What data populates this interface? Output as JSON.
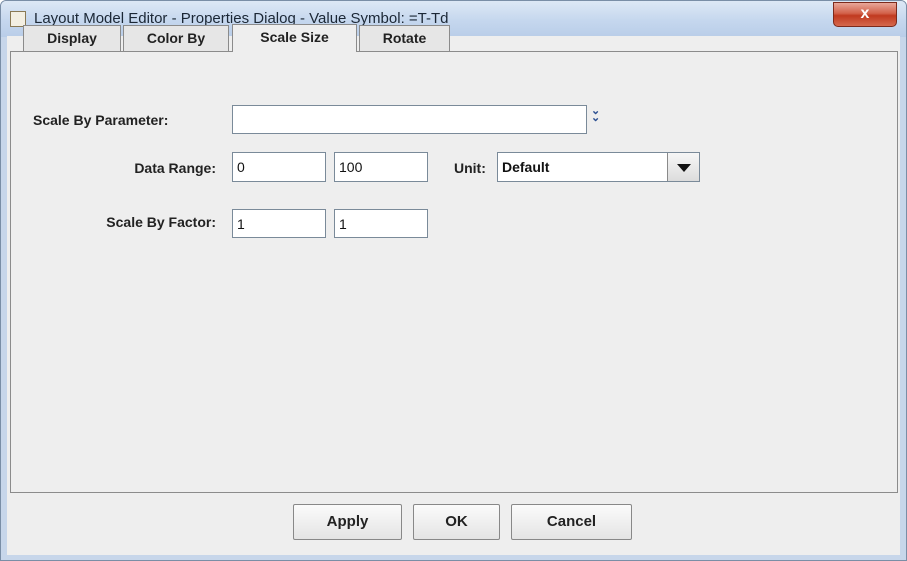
{
  "window": {
    "title": "Layout Model Editor - Properties Dialog - Value Symbol: =T-Td",
    "close_label": "x"
  },
  "tabs": [
    {
      "label": "Display",
      "selected": false
    },
    {
      "label": "Color By",
      "selected": false
    },
    {
      "label": "Scale Size",
      "selected": true
    },
    {
      "label": "Rotate",
      "selected": false
    }
  ],
  "form": {
    "scale_by_parameter": {
      "label": "Scale By Parameter:",
      "value": ""
    },
    "data_range": {
      "label": "Data Range:",
      "min": "0",
      "max": "100"
    },
    "unit": {
      "label": "Unit:",
      "value": "Default"
    },
    "scale_by_factor": {
      "label": "Scale By Factor:",
      "min": "1",
      "max": "1"
    }
  },
  "buttons": {
    "apply": "Apply",
    "ok": "OK",
    "cancel": "Cancel"
  },
  "icons": {
    "app": "java-cup-icon",
    "chevron": "double-chevron-down-icon",
    "dropdown": "triangle-down-icon"
  }
}
